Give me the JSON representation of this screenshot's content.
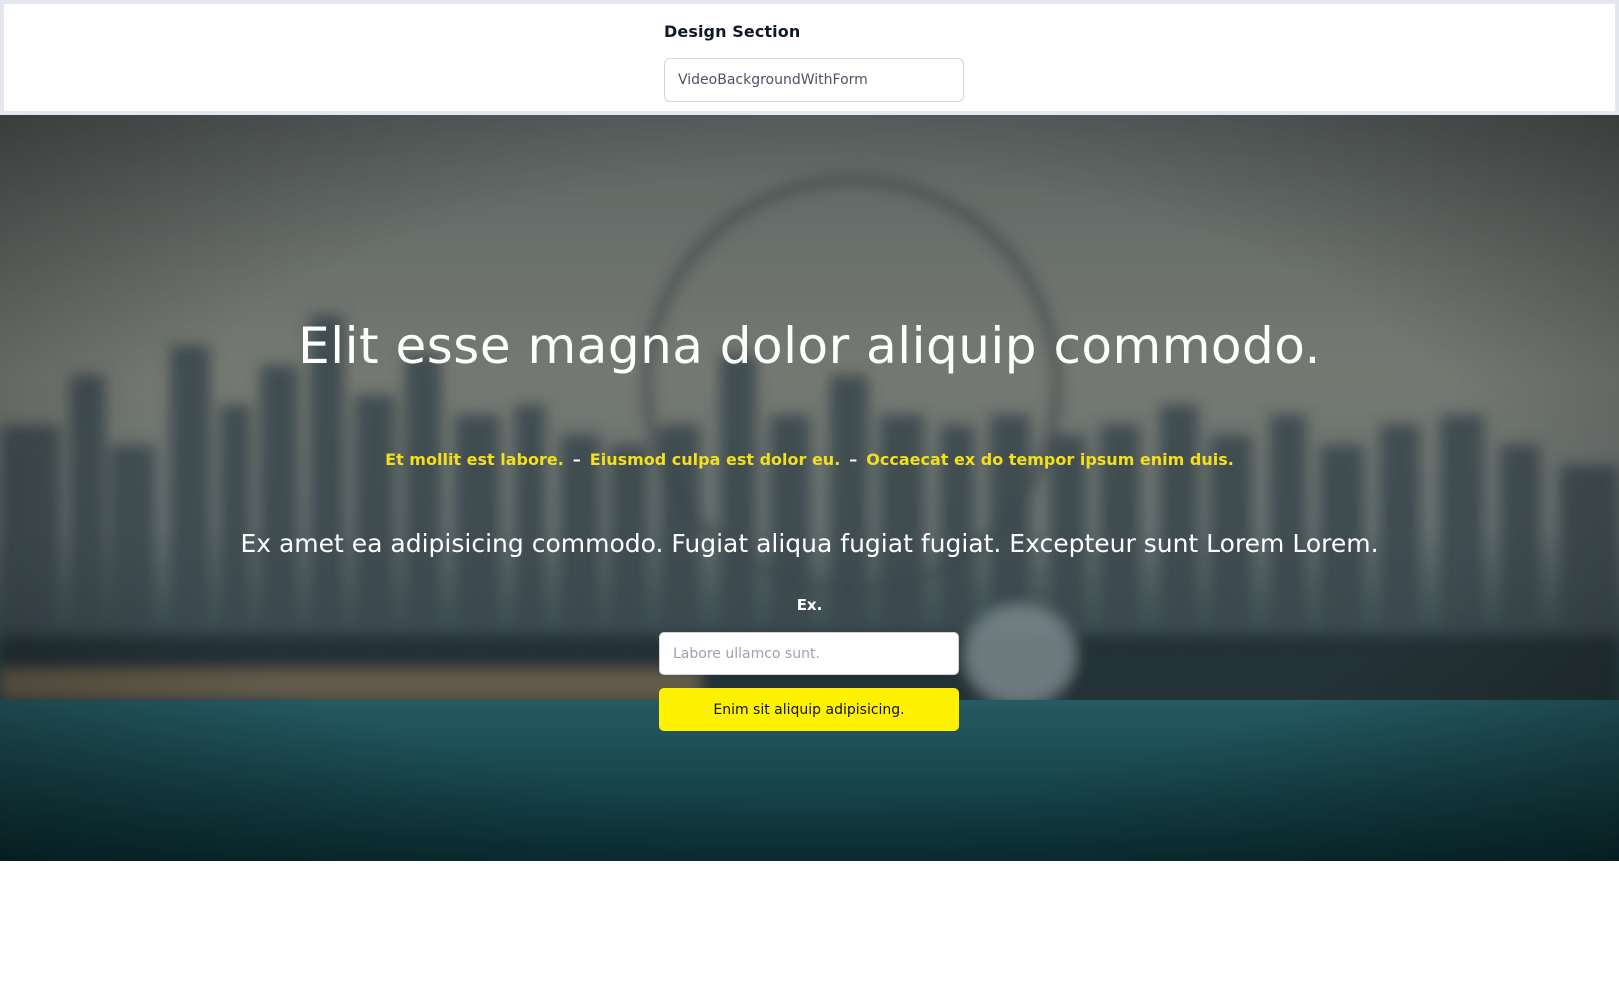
{
  "design_section": {
    "label": "Design Section",
    "selected_value": "VideoBackgroundWithForm"
  },
  "hero": {
    "background": "blurred-city-skyline-video",
    "title": "Elit esse magna dolor aliquip commodo.",
    "tagline": {
      "items": [
        "Et mollit est labore.",
        "Eiusmod culpa est dolor eu.",
        "Occaecat ex do tempor ipsum enim duis."
      ],
      "separator": "–"
    },
    "subtitle": "Ex amet ea adipisicing commodo. Fugiat aliqua fugiat fugiat. Excepteur sunt Lorem Lorem.",
    "form": {
      "label": "Ex.",
      "input_placeholder": "Labore ullamco sunt.",
      "input_value": "",
      "button_label": "Enim sit aliquip adipisicing."
    }
  },
  "colors": {
    "accent_yellow": "#fff200",
    "tagline_yellow": "#f3df1a",
    "hero_text": "#ffffff"
  }
}
